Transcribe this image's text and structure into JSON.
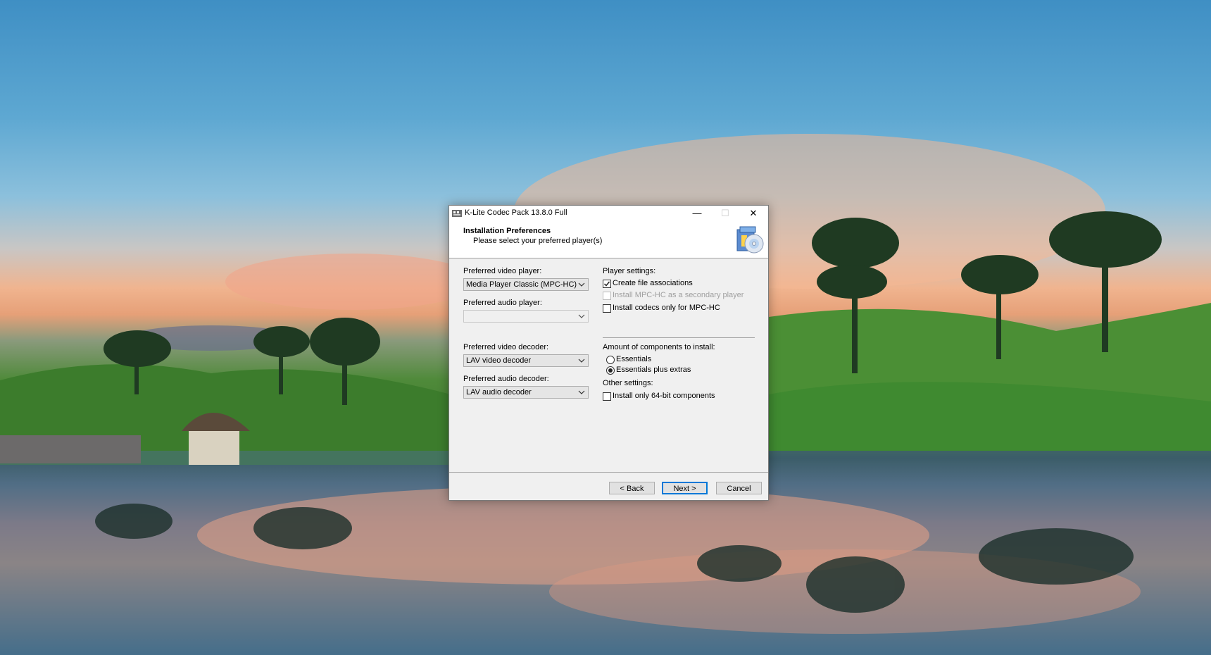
{
  "window": {
    "title": "K-Lite Codec Pack 13.8.0 Full",
    "controls": {
      "minimize": "—",
      "maximize": "☐",
      "close": "✕"
    }
  },
  "header": {
    "title": "Installation Preferences",
    "subtitle": "Please select your preferred player(s)"
  },
  "left": {
    "video_player_label": "Preferred video player:",
    "video_player_value": "Media Player Classic (MPC-HC)",
    "audio_player_label": "Preferred audio player:",
    "audio_player_value": "",
    "video_decoder_label": "Preferred video decoder:",
    "video_decoder_value": "LAV video decoder",
    "audio_decoder_label": "Preferred audio decoder:",
    "audio_decoder_value": "LAV audio decoder"
  },
  "right": {
    "player_settings_label": "Player settings:",
    "create_assoc_label": "Create file associations",
    "create_assoc_checked": true,
    "secondary_player_label": "Install MPC-HC as a secondary player",
    "secondary_player_checked": false,
    "codecs_only_label": "Install codecs only for MPC-HC",
    "codecs_only_checked": false,
    "amount_label": "Amount of components to install:",
    "essentials_label": "Essentials",
    "essentials_plus_label": "Essentials plus extras",
    "selected_amount": "Essentials plus extras",
    "other_settings_label": "Other settings:",
    "only64_label": "Install only 64-bit components",
    "only64_checked": false
  },
  "buttons": {
    "back": "< Back",
    "next": "Next >",
    "cancel": "Cancel"
  }
}
